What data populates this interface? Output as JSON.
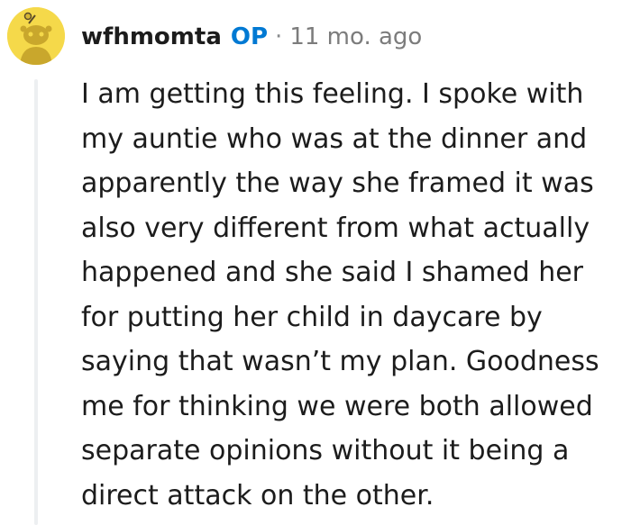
{
  "comment": {
    "author": "wfhmomta",
    "op_badge": "OP",
    "separator": "·",
    "time_ago": "11 mo. ago",
    "avatar_icon": "snoo-avatar-icon",
    "colors": {
      "avatar_bg": "#f5d94a",
      "op_badge": "#0079d3",
      "thread_line": "#edeff1"
    },
    "body_lines": [
      "I am getting this feeling. I spoke with",
      "my auntie who was at the dinner and",
      "apparently the way she framed it was",
      "also very different from what actually",
      "happened and she said I shamed her",
      "for putting her child in daycare by",
      "saying that wasn’t my plan. Goodness",
      "me for thinking we were both allowed",
      "separate opinions without it being a",
      "direct attack on the other."
    ]
  }
}
